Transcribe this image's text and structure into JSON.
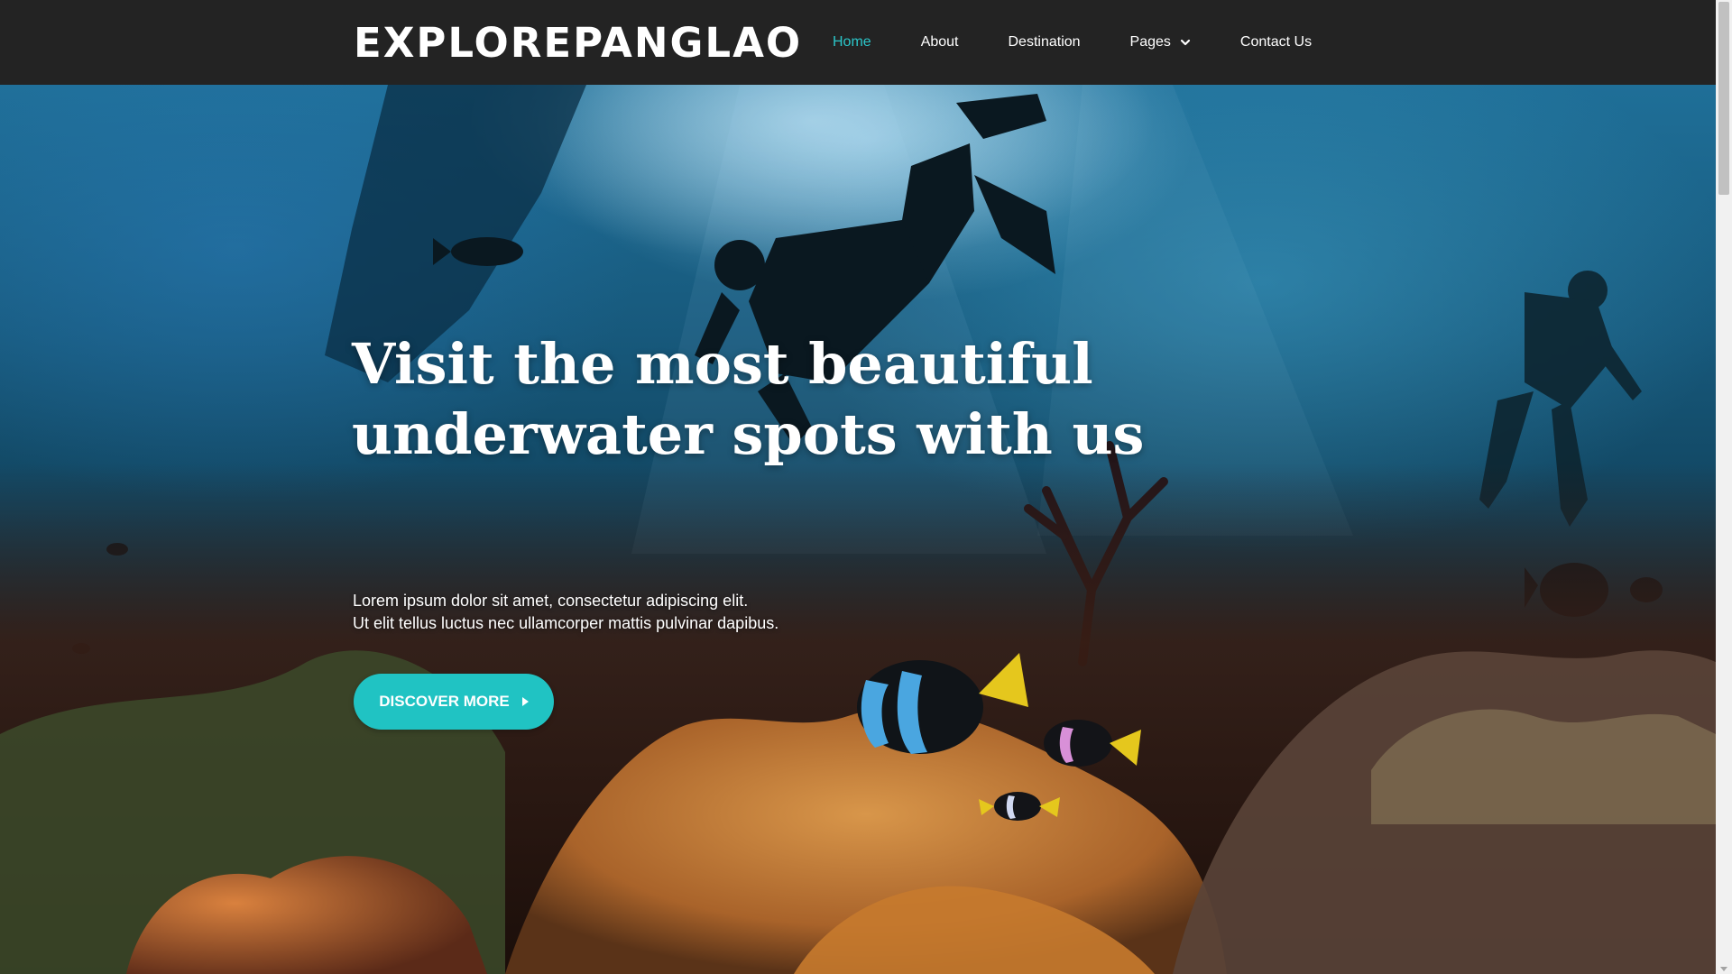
{
  "header": {
    "logo": {
      "part1": "EXPLORE",
      "part2": "PANGLAO",
      "accent_color": "#f28a1d"
    },
    "nav": [
      {
        "label": "Home",
        "active": true
      },
      {
        "label": "About",
        "active": false
      },
      {
        "label": "Destination",
        "active": false
      },
      {
        "label": "Pages",
        "active": false,
        "has_dropdown": true,
        "icon": "chevron-down-icon"
      },
      {
        "label": "Contact Us",
        "active": false
      }
    ],
    "background_color": "#232323",
    "active_color": "#2bc6c9"
  },
  "hero": {
    "title": "Visit the most beautiful underwater spots with us",
    "text_line1": "Lorem ipsum dolor sit amet, consectetur adipiscing elit.",
    "text_line2": "Ut elit tellus luctus nec ullamcorper mattis pulvinar dapibus.",
    "cta_label": "DISCOVER MORE",
    "cta_icon": "caret-right-icon",
    "cta_color": "#20c3c3"
  }
}
